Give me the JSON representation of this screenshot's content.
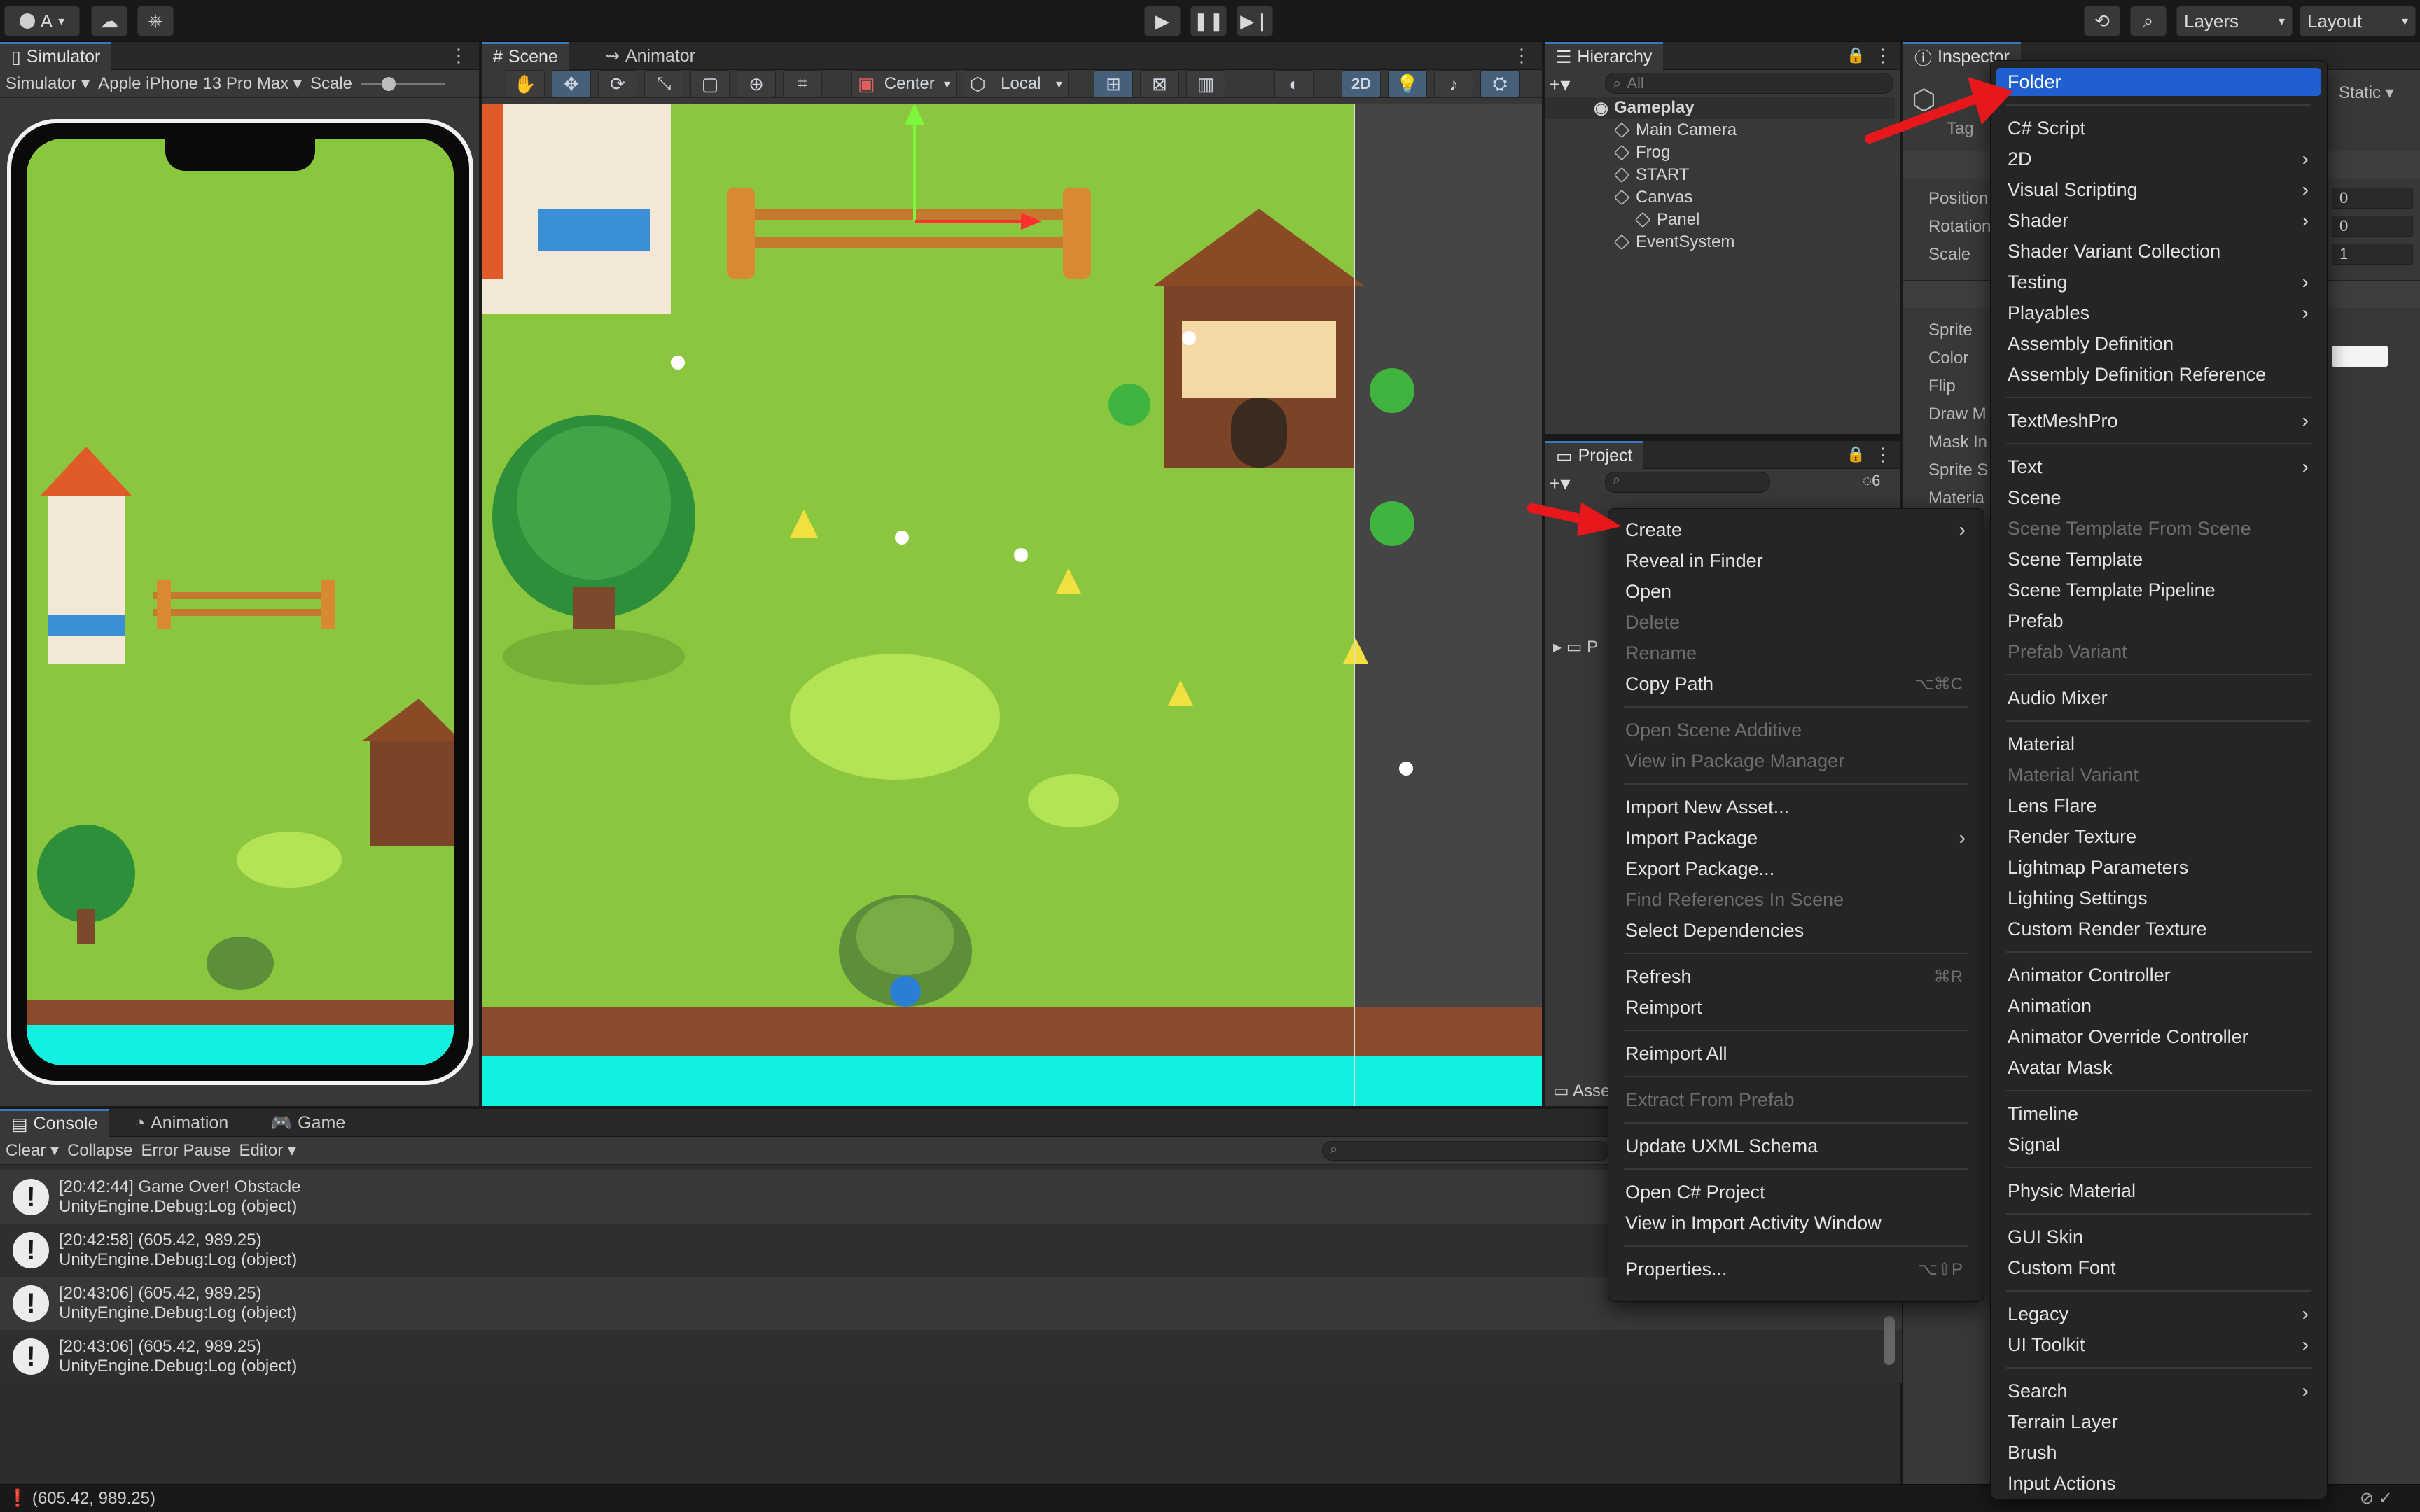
{
  "toolbar": {
    "account_label": "A",
    "layers_label": "Layers",
    "layout_label": "Layout"
  },
  "simulator": {
    "tab": "Simulator",
    "mode_select": "Simulator",
    "device_select": "Apple iPhone 13 Pro Max",
    "scale_label": "Scale"
  },
  "scene": {
    "tabs": [
      "Scene",
      "Animator"
    ],
    "pivot_select": "Center",
    "space_select": "Local",
    "mode_2d": "2D"
  },
  "hierarchy": {
    "tab": "Hierarchy",
    "search_placeholder": "All",
    "root": "Gameplay",
    "items": [
      "Main Camera",
      "Frog",
      "START",
      "Canvas",
      "Panel",
      "EventSystem"
    ]
  },
  "project": {
    "tab": "Project",
    "badge_count": "6",
    "partial_item": "P",
    "bottom_label": "Asse"
  },
  "inspector": {
    "tab": "Inspector",
    "static_label": "Static",
    "tag_label": "Tag",
    "transform_props": [
      "Position",
      "Rotation",
      "Scale"
    ],
    "transform_values": [
      "0",
      "0",
      "1"
    ],
    "renderer_props": [
      "Sprite",
      "Color",
      "Flip",
      "Draw M",
      "Mask In",
      "Sprite S",
      "Materia"
    ]
  },
  "console": {
    "tabs": [
      "Console",
      "Animation",
      "Game"
    ],
    "clear_label": "Clear",
    "collapse_label": "Collapse",
    "error_pause_label": "Error Pause",
    "editor_label": "Editor",
    "entries": [
      {
        "line1": "[20:42:44] Game Over! Obstacle",
        "line2": "UnityEngine.Debug:Log (object)"
      },
      {
        "line1": "[20:42:58] (605.42, 989.25)",
        "line2": "UnityEngine.Debug:Log (object)"
      },
      {
        "line1": "[20:43:06] (605.42, 989.25)",
        "line2": "UnityEngine.Debug:Log (object)"
      },
      {
        "line1": "[20:43:06] (605.42, 989.25)",
        "line2": "UnityEngine.Debug:Log (object)"
      }
    ]
  },
  "status_bar": {
    "text": "(605.42, 989.25)"
  },
  "context_menu": {
    "items": [
      {
        "label": "Create",
        "submenu": true
      },
      {
        "label": "Reveal in Finder"
      },
      {
        "label": "Open"
      },
      {
        "label": "Delete",
        "disabled": true
      },
      {
        "label": "Rename",
        "disabled": true
      },
      {
        "label": "Copy Path",
        "shortcut": "⌥⌘C"
      },
      {
        "label": "Open Scene Additive",
        "disabled": true
      },
      {
        "label": "View in Package Manager",
        "disabled": true
      },
      {
        "label": "Import New Asset..."
      },
      {
        "label": "Import Package",
        "submenu": true
      },
      {
        "label": "Export Package..."
      },
      {
        "label": "Find References In Scene",
        "disabled": true
      },
      {
        "label": "Select Dependencies"
      },
      {
        "label": "Refresh",
        "shortcut": "⌘R"
      },
      {
        "label": "Reimport"
      },
      {
        "label": "Reimport All"
      },
      {
        "label": "Extract From Prefab",
        "disabled": true
      },
      {
        "label": "Update UXML Schema"
      },
      {
        "label": "Open C# Project"
      },
      {
        "label": "View in Import Activity Window"
      },
      {
        "label": "Properties...",
        "shortcut": "⌥⇧P"
      }
    ]
  },
  "create_menu": {
    "items": [
      {
        "label": "Folder",
        "selected": true
      },
      {
        "label": "C# Script"
      },
      {
        "label": "2D",
        "submenu": true
      },
      {
        "label": "Visual Scripting",
        "submenu": true
      },
      {
        "label": "Shader",
        "submenu": true
      },
      {
        "label": "Shader Variant Collection"
      },
      {
        "label": "Testing",
        "submenu": true
      },
      {
        "label": "Playables",
        "submenu": true
      },
      {
        "label": "Assembly Definition"
      },
      {
        "label": "Assembly Definition Reference"
      },
      {
        "label": "TextMeshPro",
        "submenu": true
      },
      {
        "label": "Text",
        "submenu": true
      },
      {
        "label": "Scene"
      },
      {
        "label": "Scene Template From Scene",
        "disabled": true
      },
      {
        "label": "Scene Template"
      },
      {
        "label": "Scene Template Pipeline"
      },
      {
        "label": "Prefab"
      },
      {
        "label": "Prefab Variant",
        "disabled": true
      },
      {
        "label": "Audio Mixer"
      },
      {
        "label": "Material"
      },
      {
        "label": "Material Variant",
        "disabled": true
      },
      {
        "label": "Lens Flare"
      },
      {
        "label": "Render Texture"
      },
      {
        "label": "Lightmap Parameters"
      },
      {
        "label": "Lighting Settings"
      },
      {
        "label": "Custom Render Texture"
      },
      {
        "label": "Animator Controller"
      },
      {
        "label": "Animation"
      },
      {
        "label": "Animator Override Controller"
      },
      {
        "label": "Avatar Mask"
      },
      {
        "label": "Timeline"
      },
      {
        "label": "Signal"
      },
      {
        "label": "Physic Material"
      },
      {
        "label": "GUI Skin"
      },
      {
        "label": "Custom Font"
      },
      {
        "label": "Legacy",
        "submenu": true
      },
      {
        "label": "UI Toolkit",
        "submenu": true
      },
      {
        "label": "Search",
        "submenu": true
      },
      {
        "label": "Terrain Layer"
      },
      {
        "label": "Brush"
      },
      {
        "label": "Input Actions"
      }
    ]
  },
  "colors": {
    "accent": "#1f5fcf",
    "grass": "#8bc63f",
    "water": "#12f0e0",
    "annotation_arrow": "#e8171c"
  }
}
